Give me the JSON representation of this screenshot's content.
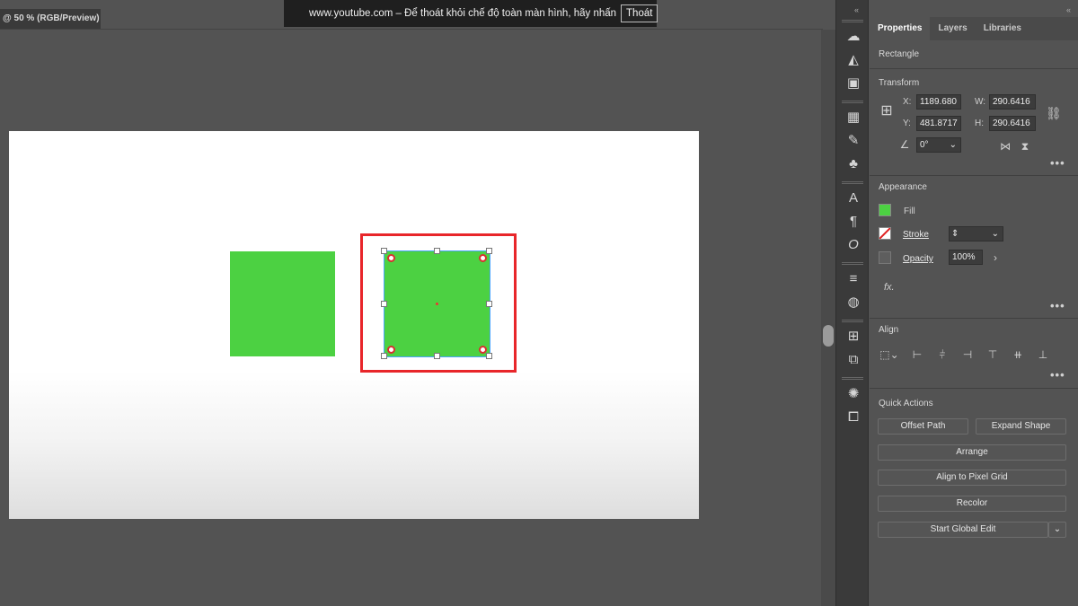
{
  "document": {
    "tab_title": "@ 50 % (RGB/Preview)"
  },
  "banner": {
    "message": "www.youtube.com – Để thoát khỏi chế độ toàn màn hình, hãy nhấn",
    "exit_label": "Thoát"
  },
  "canvas": {
    "fill_color": "#4cd142",
    "highlight_color": "#e8262a"
  },
  "panel": {
    "tabs": [
      "Properties",
      "Layers",
      "Libraries"
    ],
    "object_type": "Rectangle",
    "transform": {
      "title": "Transform",
      "x_label": "X:",
      "x_value": "1189.680",
      "y_label": "Y:",
      "y_value": "481.8717",
      "w_label": "W:",
      "w_value": "290.6416",
      "h_label": "H:",
      "h_value": "290.6416",
      "angle_value": "0°"
    },
    "appearance": {
      "title": "Appearance",
      "fill_label": "Fill",
      "stroke_label": "Stroke",
      "opacity_label": "Opacity",
      "opacity_value": "100%",
      "fx_label": "fx."
    },
    "align": {
      "title": "Align"
    },
    "quick_actions": {
      "title": "Quick Actions",
      "offset_path": "Offset Path",
      "expand_shape": "Expand Shape",
      "arrange": "Arrange",
      "align_pixel": "Align to Pixel Grid",
      "recolor": "Recolor",
      "global_edit": "Start Global Edit"
    }
  },
  "tool_icons": [
    "libraries-icon",
    "gradient-icon",
    "transparency-icon",
    "swatches-icon",
    "brushes-icon",
    "symbols-icon",
    "character-icon",
    "paragraph-icon",
    "opentype-icon",
    "stroke-panel-icon",
    "appearance-panel-icon",
    "transform-panel-icon",
    "pathfinder-icon",
    "color-guide-icon",
    "artboards-icon"
  ]
}
